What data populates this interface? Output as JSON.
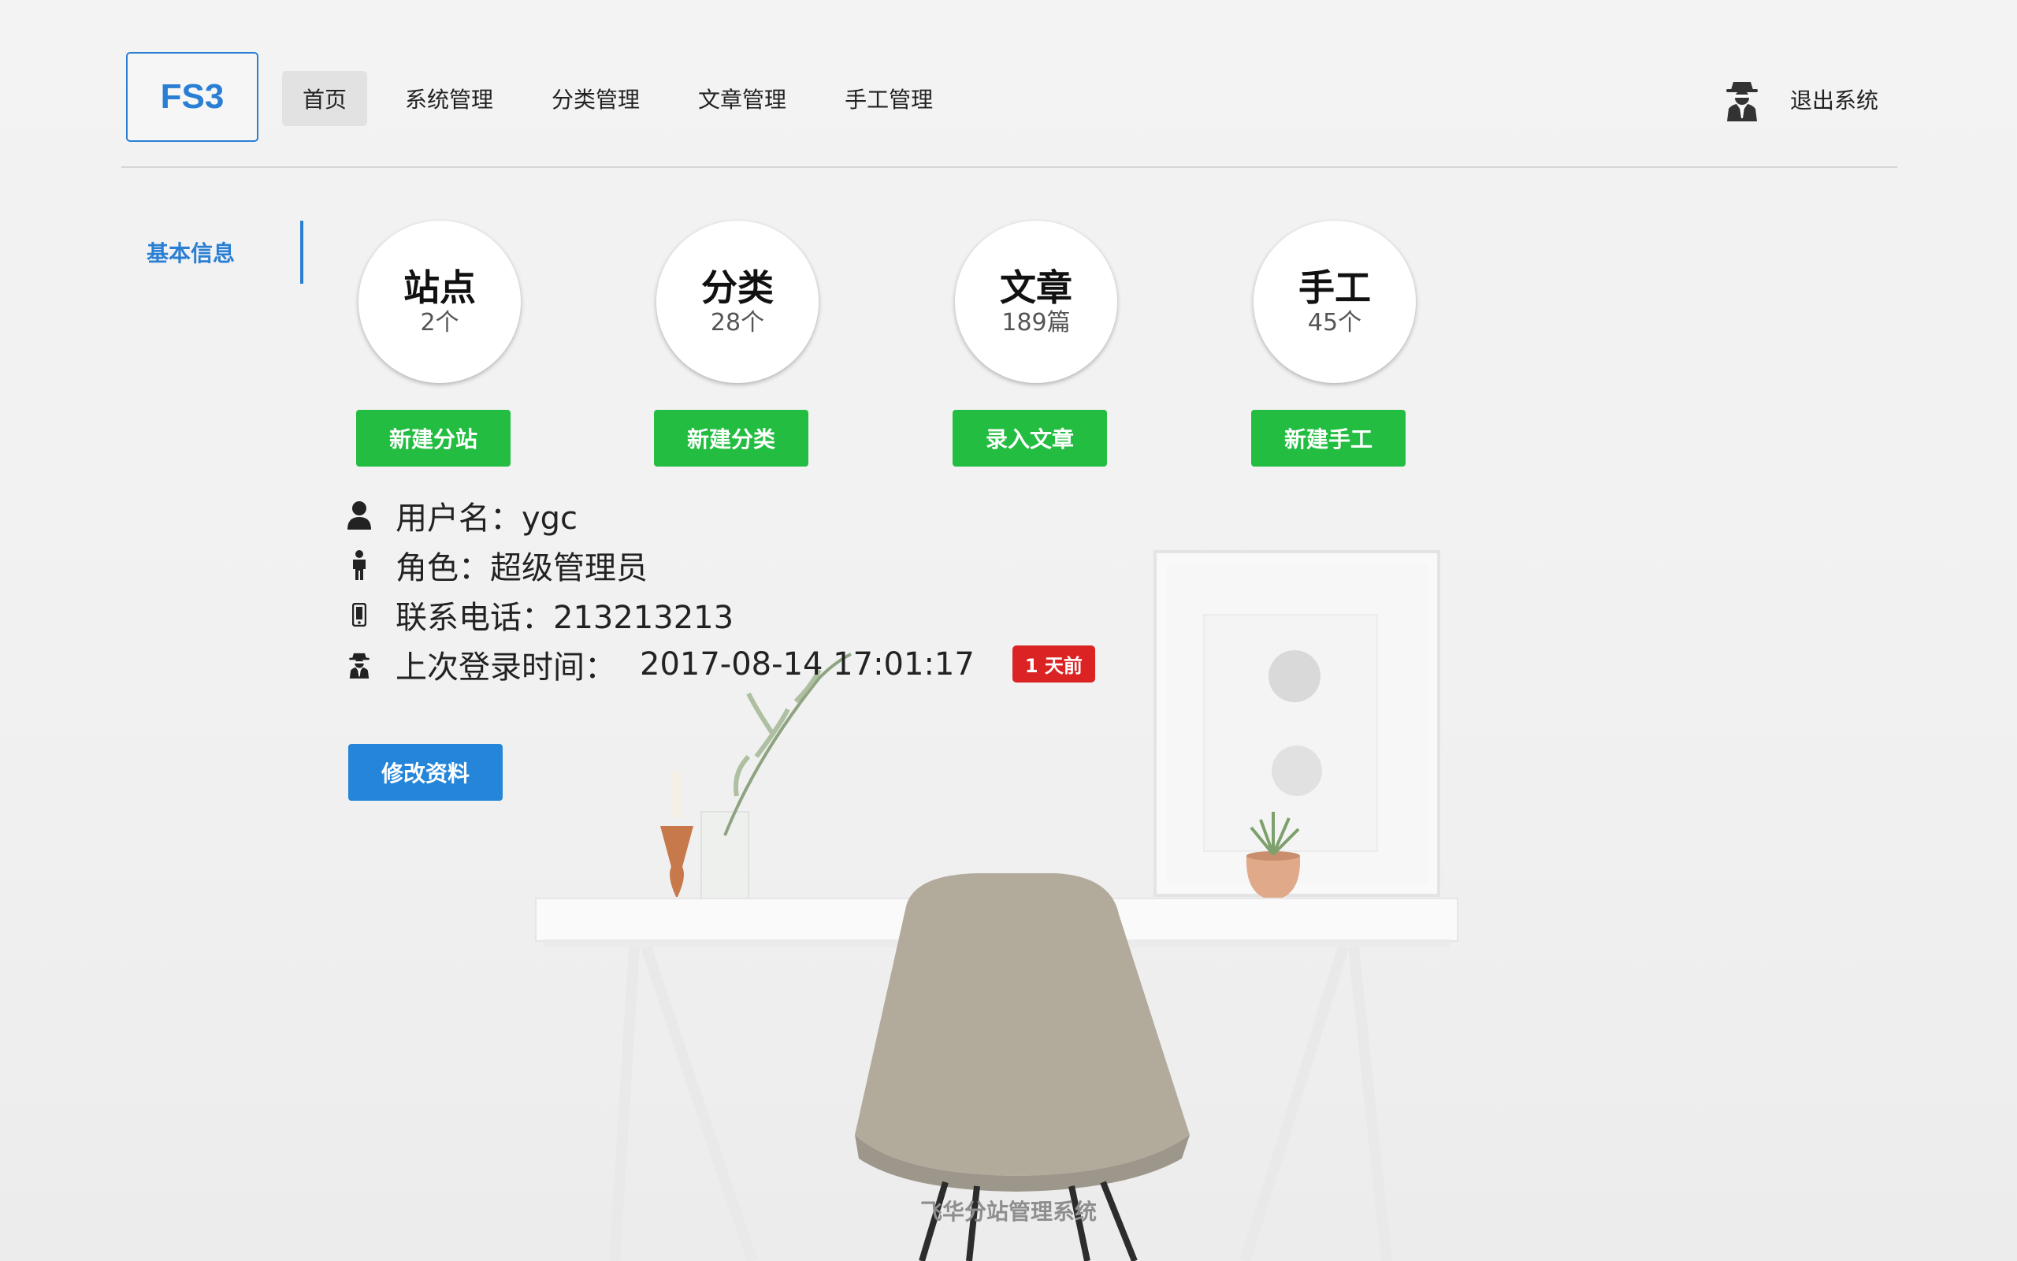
{
  "header": {
    "logo": "FS3",
    "nav": [
      {
        "label": "首页",
        "active": true
      },
      {
        "label": "系统管理",
        "active": false
      },
      {
        "label": "分类管理",
        "active": false
      },
      {
        "label": "文章管理",
        "active": false
      },
      {
        "label": "手工管理",
        "active": false
      }
    ],
    "logout_label": "退出系统",
    "logout_icon": "user-secret-icon"
  },
  "sidebar": {
    "items": [
      {
        "label": "基本信息",
        "active": true
      }
    ]
  },
  "stats": [
    {
      "title": "站点",
      "count": "2个",
      "button": "新建分站"
    },
    {
      "title": "分类",
      "count": "28个",
      "button": "新建分类"
    },
    {
      "title": "文章",
      "count": "189篇",
      "button": "录入文章"
    },
    {
      "title": "手工",
      "count": "45个",
      "button": "新建手工"
    }
  ],
  "user": {
    "username": "用户名：ygc",
    "role": "角色：超级管理员",
    "phone": "联系电话：213213213",
    "last_login_label": "上次登录时间：",
    "last_login_time": "2017-08-14 17:01:17",
    "last_login_badge": "1 天前"
  },
  "edit_button": "修改资料",
  "footer": {
    "title": "飞华分站管理系统"
  },
  "colors": {
    "accent": "#2a7fd4",
    "success": "#23bd41",
    "danger": "#db2323",
    "primary_button": "#2585d9"
  }
}
